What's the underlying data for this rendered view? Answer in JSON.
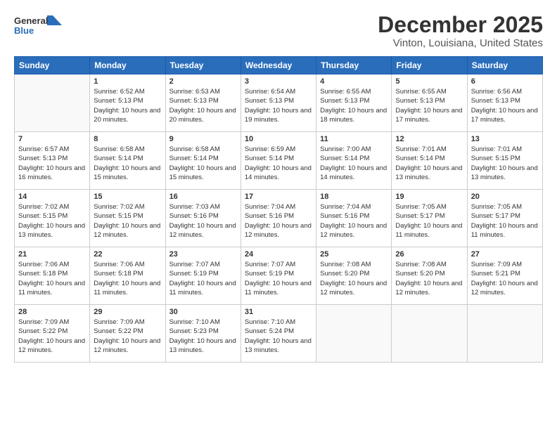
{
  "header": {
    "logo_general": "General",
    "logo_blue": "Blue",
    "month_title": "December 2025",
    "location": "Vinton, Louisiana, United States"
  },
  "weekdays": [
    "Sunday",
    "Monday",
    "Tuesday",
    "Wednesday",
    "Thursday",
    "Friday",
    "Saturday"
  ],
  "weeks": [
    [
      {
        "day": "",
        "empty": true
      },
      {
        "day": "1",
        "sunrise": "Sunrise: 6:52 AM",
        "sunset": "Sunset: 5:13 PM",
        "daylight": "Daylight: 10 hours and 20 minutes."
      },
      {
        "day": "2",
        "sunrise": "Sunrise: 6:53 AM",
        "sunset": "Sunset: 5:13 PM",
        "daylight": "Daylight: 10 hours and 20 minutes."
      },
      {
        "day": "3",
        "sunrise": "Sunrise: 6:54 AM",
        "sunset": "Sunset: 5:13 PM",
        "daylight": "Daylight: 10 hours and 19 minutes."
      },
      {
        "day": "4",
        "sunrise": "Sunrise: 6:55 AM",
        "sunset": "Sunset: 5:13 PM",
        "daylight": "Daylight: 10 hours and 18 minutes."
      },
      {
        "day": "5",
        "sunrise": "Sunrise: 6:55 AM",
        "sunset": "Sunset: 5:13 PM",
        "daylight": "Daylight: 10 hours and 17 minutes."
      },
      {
        "day": "6",
        "sunrise": "Sunrise: 6:56 AM",
        "sunset": "Sunset: 5:13 PM",
        "daylight": "Daylight: 10 hours and 17 minutes."
      }
    ],
    [
      {
        "day": "7",
        "sunrise": "Sunrise: 6:57 AM",
        "sunset": "Sunset: 5:13 PM",
        "daylight": "Daylight: 10 hours and 16 minutes."
      },
      {
        "day": "8",
        "sunrise": "Sunrise: 6:58 AM",
        "sunset": "Sunset: 5:14 PM",
        "daylight": "Daylight: 10 hours and 15 minutes."
      },
      {
        "day": "9",
        "sunrise": "Sunrise: 6:58 AM",
        "sunset": "Sunset: 5:14 PM",
        "daylight": "Daylight: 10 hours and 15 minutes."
      },
      {
        "day": "10",
        "sunrise": "Sunrise: 6:59 AM",
        "sunset": "Sunset: 5:14 PM",
        "daylight": "Daylight: 10 hours and 14 minutes."
      },
      {
        "day": "11",
        "sunrise": "Sunrise: 7:00 AM",
        "sunset": "Sunset: 5:14 PM",
        "daylight": "Daylight: 10 hours and 14 minutes."
      },
      {
        "day": "12",
        "sunrise": "Sunrise: 7:01 AM",
        "sunset": "Sunset: 5:14 PM",
        "daylight": "Daylight: 10 hours and 13 minutes."
      },
      {
        "day": "13",
        "sunrise": "Sunrise: 7:01 AM",
        "sunset": "Sunset: 5:15 PM",
        "daylight": "Daylight: 10 hours and 13 minutes."
      }
    ],
    [
      {
        "day": "14",
        "sunrise": "Sunrise: 7:02 AM",
        "sunset": "Sunset: 5:15 PM",
        "daylight": "Daylight: 10 hours and 13 minutes."
      },
      {
        "day": "15",
        "sunrise": "Sunrise: 7:02 AM",
        "sunset": "Sunset: 5:15 PM",
        "daylight": "Daylight: 10 hours and 12 minutes."
      },
      {
        "day": "16",
        "sunrise": "Sunrise: 7:03 AM",
        "sunset": "Sunset: 5:16 PM",
        "daylight": "Daylight: 10 hours and 12 minutes."
      },
      {
        "day": "17",
        "sunrise": "Sunrise: 7:04 AM",
        "sunset": "Sunset: 5:16 PM",
        "daylight": "Daylight: 10 hours and 12 minutes."
      },
      {
        "day": "18",
        "sunrise": "Sunrise: 7:04 AM",
        "sunset": "Sunset: 5:16 PM",
        "daylight": "Daylight: 10 hours and 12 minutes."
      },
      {
        "day": "19",
        "sunrise": "Sunrise: 7:05 AM",
        "sunset": "Sunset: 5:17 PM",
        "daylight": "Daylight: 10 hours and 11 minutes."
      },
      {
        "day": "20",
        "sunrise": "Sunrise: 7:05 AM",
        "sunset": "Sunset: 5:17 PM",
        "daylight": "Daylight: 10 hours and 11 minutes."
      }
    ],
    [
      {
        "day": "21",
        "sunrise": "Sunrise: 7:06 AM",
        "sunset": "Sunset: 5:18 PM",
        "daylight": "Daylight: 10 hours and 11 minutes."
      },
      {
        "day": "22",
        "sunrise": "Sunrise: 7:06 AM",
        "sunset": "Sunset: 5:18 PM",
        "daylight": "Daylight: 10 hours and 11 minutes."
      },
      {
        "day": "23",
        "sunrise": "Sunrise: 7:07 AM",
        "sunset": "Sunset: 5:19 PM",
        "daylight": "Daylight: 10 hours and 11 minutes."
      },
      {
        "day": "24",
        "sunrise": "Sunrise: 7:07 AM",
        "sunset": "Sunset: 5:19 PM",
        "daylight": "Daylight: 10 hours and 11 minutes."
      },
      {
        "day": "25",
        "sunrise": "Sunrise: 7:08 AM",
        "sunset": "Sunset: 5:20 PM",
        "daylight": "Daylight: 10 hours and 12 minutes."
      },
      {
        "day": "26",
        "sunrise": "Sunrise: 7:08 AM",
        "sunset": "Sunset: 5:20 PM",
        "daylight": "Daylight: 10 hours and 12 minutes."
      },
      {
        "day": "27",
        "sunrise": "Sunrise: 7:09 AM",
        "sunset": "Sunset: 5:21 PM",
        "daylight": "Daylight: 10 hours and 12 minutes."
      }
    ],
    [
      {
        "day": "28",
        "sunrise": "Sunrise: 7:09 AM",
        "sunset": "Sunset: 5:22 PM",
        "daylight": "Daylight: 10 hours and 12 minutes."
      },
      {
        "day": "29",
        "sunrise": "Sunrise: 7:09 AM",
        "sunset": "Sunset: 5:22 PM",
        "daylight": "Daylight: 10 hours and 12 minutes."
      },
      {
        "day": "30",
        "sunrise": "Sunrise: 7:10 AM",
        "sunset": "Sunset: 5:23 PM",
        "daylight": "Daylight: 10 hours and 13 minutes."
      },
      {
        "day": "31",
        "sunrise": "Sunrise: 7:10 AM",
        "sunset": "Sunset: 5:24 PM",
        "daylight": "Daylight: 10 hours and 13 minutes."
      },
      {
        "day": "",
        "empty": true
      },
      {
        "day": "",
        "empty": true
      },
      {
        "day": "",
        "empty": true
      }
    ]
  ]
}
